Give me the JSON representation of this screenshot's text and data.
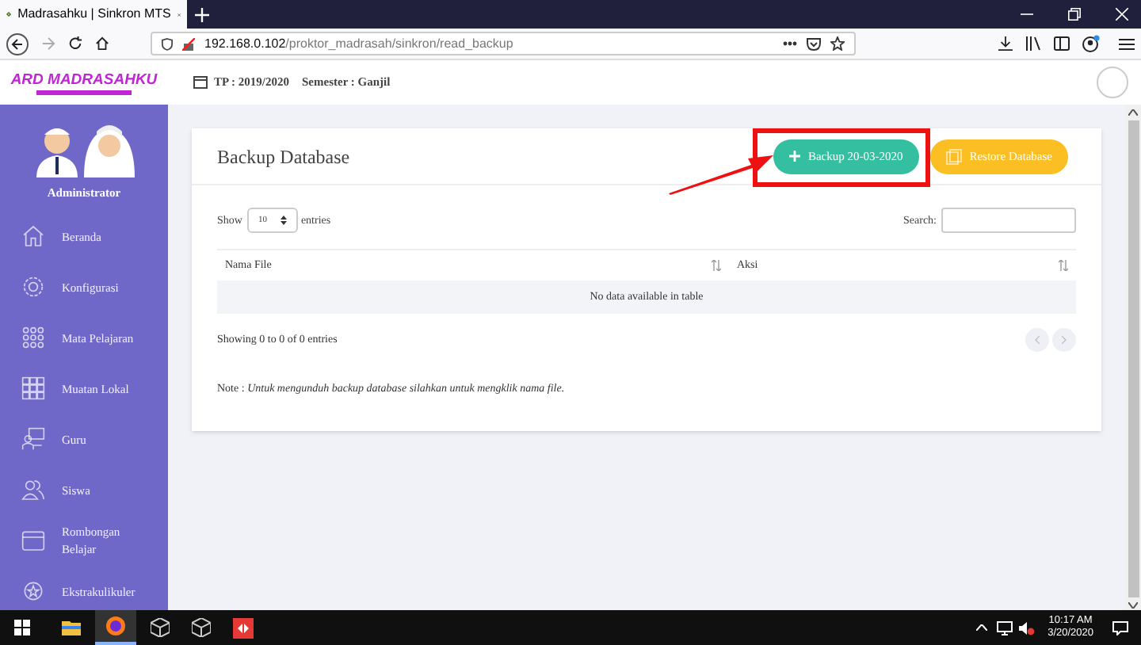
{
  "browser": {
    "tab_title": "Madrasahku | Sinkron MTS",
    "url_host": "192.168.0.102",
    "url_path": "/proktor_madrasah/sinkron/read_backup"
  },
  "header": {
    "logo": "ARD MADRASAHKU",
    "school_year": "TP : 2019/2020",
    "semester": "Semester : Ganjil"
  },
  "sidebar": {
    "user": "Administrator",
    "items": [
      {
        "label": "Beranda",
        "kind": "home"
      },
      {
        "label": "Konfigurasi",
        "kind": "gear"
      },
      {
        "label": "Mata Pelajaran",
        "kind": "dots"
      },
      {
        "label": "Muatan Lokal",
        "kind": "grid"
      },
      {
        "label": "Guru",
        "kind": "teacher"
      },
      {
        "label": "Siswa",
        "kind": "users"
      },
      {
        "label": "Rombongan Belajar",
        "kind": "box"
      },
      {
        "label": "Ekstrakulikuler",
        "kind": "badge"
      }
    ]
  },
  "card": {
    "title": "Backup Database",
    "buttons": [
      {
        "label": "Backup 20-03-2020",
        "kind": "backup",
        "highlighted": true
      },
      {
        "label": "Restore Database",
        "kind": "restore",
        "highlighted": false
      }
    ],
    "length_label_before": "Show",
    "length_value": "10",
    "length_label_after": "entries",
    "search_label": "Search:",
    "table": {
      "columns": [
        "Nama File",
        "Aksi"
      ],
      "empty_text": "No data available in table"
    },
    "info": "Showing 0 to 0 of 0 entries",
    "note": "Note : *Untuk mengunduh backup database silahkan untuk mengklik nama file.*"
  },
  "taskbar": {
    "time": "10:17 AM",
    "date": "3/20/2020"
  }
}
